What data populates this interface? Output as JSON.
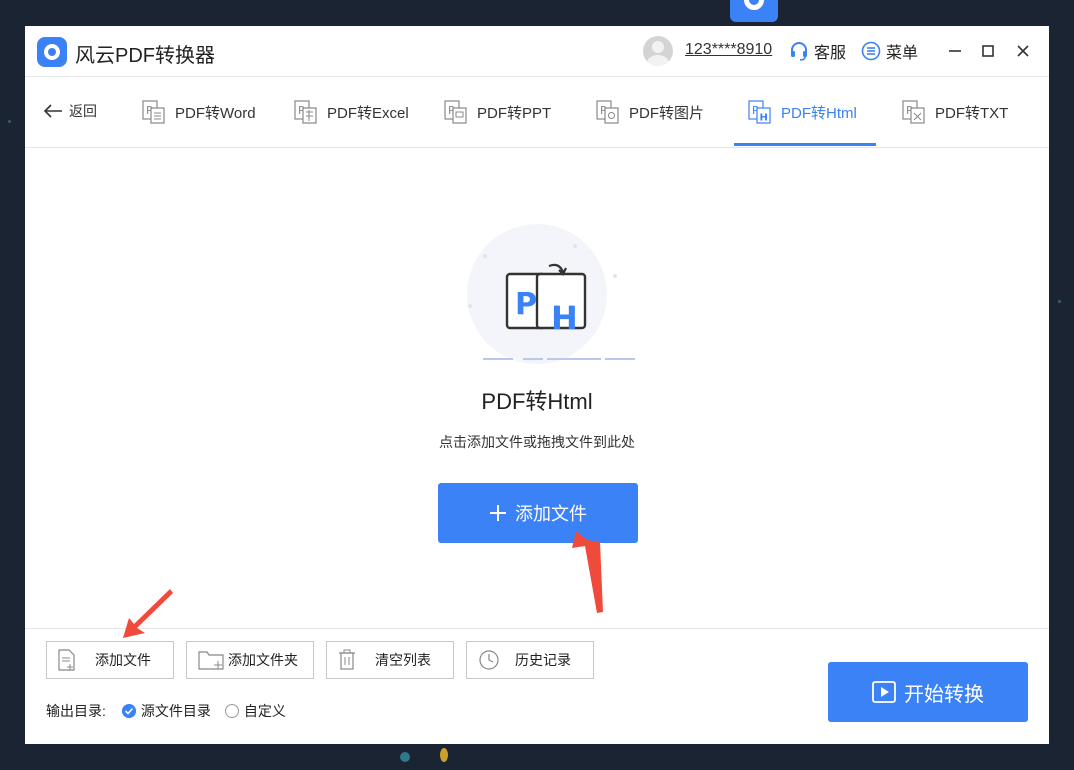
{
  "app": {
    "title": "风云PDF转换器"
  },
  "header": {
    "user": "123****8910",
    "service_label": "客服",
    "menu_label": "菜单"
  },
  "nav": {
    "back_label": "返回",
    "tabs": [
      {
        "label": "PDF转Word",
        "icon": "pdf-word-icon"
      },
      {
        "label": "PDF转Excel",
        "icon": "pdf-excel-icon"
      },
      {
        "label": "PDF转PPT",
        "icon": "pdf-ppt-icon"
      },
      {
        "label": "PDF转图片",
        "icon": "pdf-image-icon"
      },
      {
        "label": "PDF转Html",
        "icon": "pdf-html-icon",
        "active": true
      },
      {
        "label": "PDF转TXT",
        "icon": "pdf-txt-icon"
      }
    ]
  },
  "main": {
    "title": "PDF转Html",
    "subtitle": "点击添加文件或拖拽文件到此处",
    "add_button": "添加文件"
  },
  "toolbar": {
    "add_file": "添加文件",
    "add_folder": "添加文件夹",
    "clear_list": "清空列表",
    "history": "历史记录"
  },
  "output": {
    "label": "输出目录:",
    "options": [
      {
        "label": "源文件目录",
        "selected": true
      },
      {
        "label": "自定义",
        "selected": false
      }
    ]
  },
  "start_button": "开始转换",
  "colors": {
    "accent": "#3b82f6",
    "annotation_arrow": "#f04a3a",
    "desktop": "#1b2433"
  }
}
